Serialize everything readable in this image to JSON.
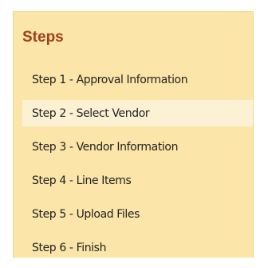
{
  "steps_panel": {
    "title": "Steps",
    "items": [
      {
        "label": "Step 1 - Approval Information",
        "active": false
      },
      {
        "label": "Step 2 - Select Vendor",
        "active": true
      },
      {
        "label": "Step 3 - Vendor Information",
        "active": false
      },
      {
        "label": "Step 4 - Line Items",
        "active": false
      },
      {
        "label": "Step 5 - Upload Files",
        "active": false
      },
      {
        "label": "Step 6 - Finish",
        "active": false
      }
    ]
  },
  "colors": {
    "panel_background": "#fbe5a8",
    "title_color": "#a0401c",
    "active_item_background": "#fdf1d4"
  }
}
